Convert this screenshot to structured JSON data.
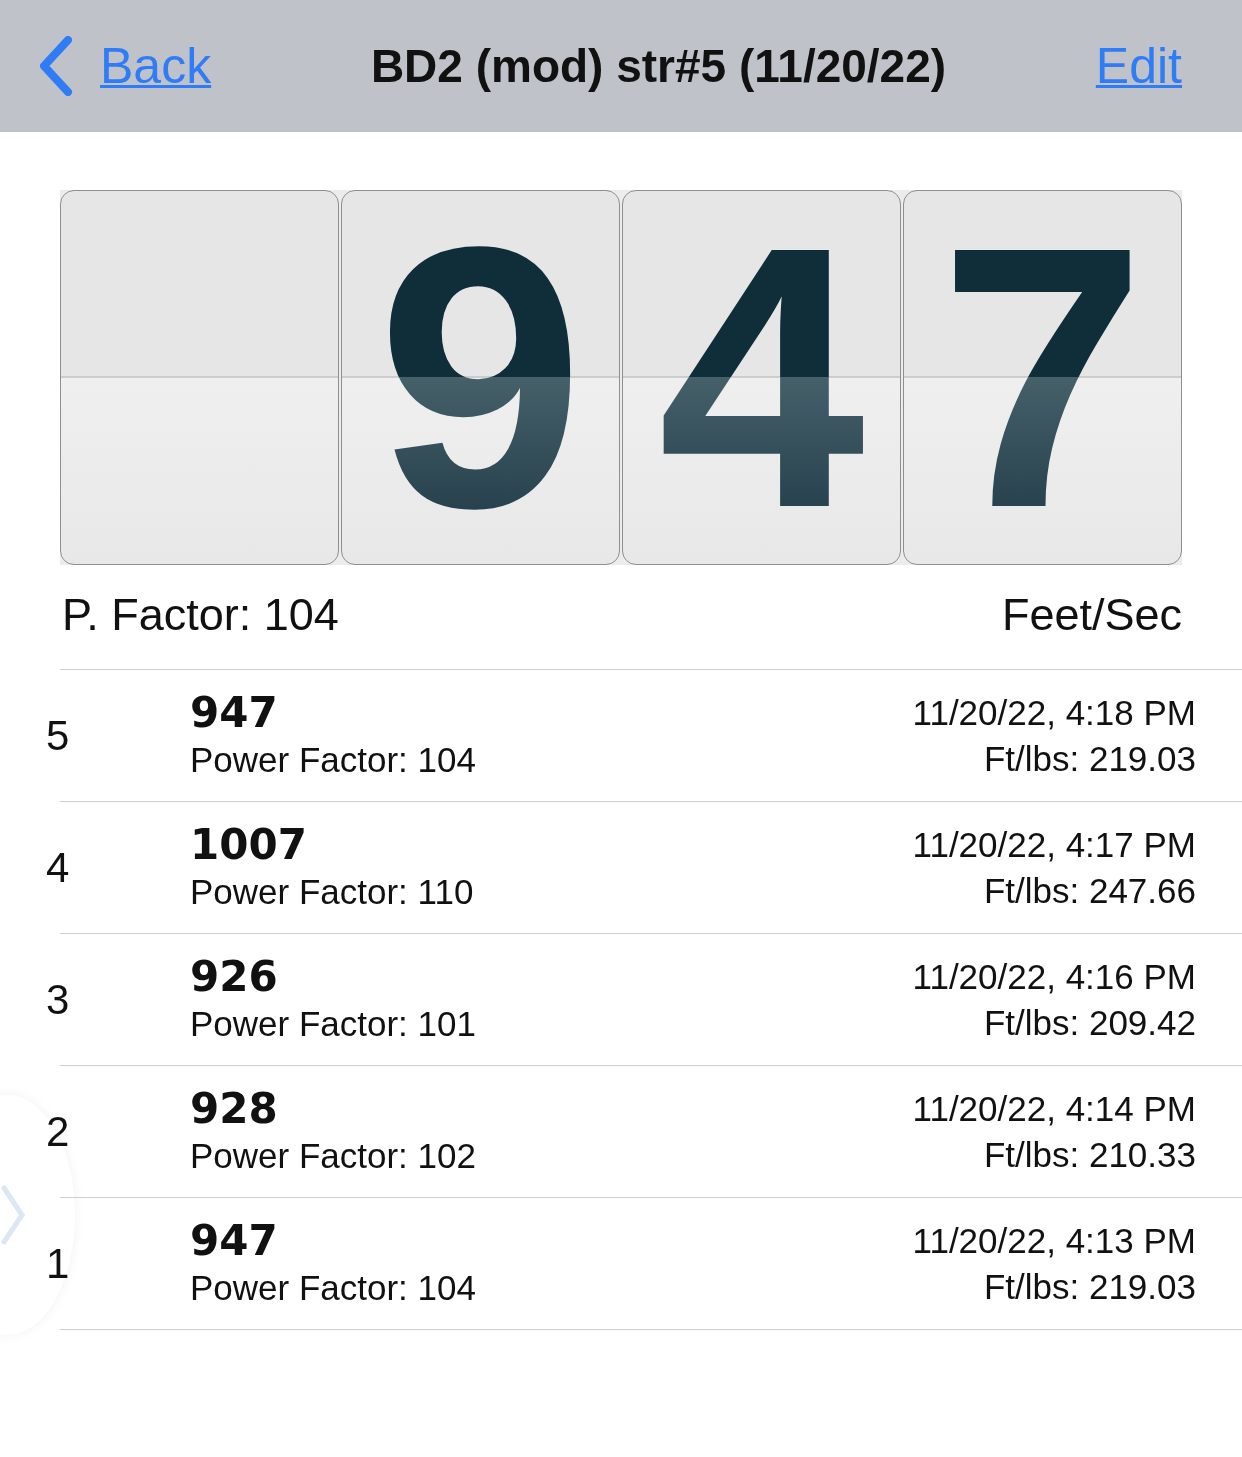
{
  "nav": {
    "back": "Back",
    "title": "BD2 (mod) str#5 (11/20/22)",
    "edit": "Edit"
  },
  "display": {
    "cards": [
      {
        "kind": "blank"
      },
      {
        "kind": "digit",
        "value": "9"
      },
      {
        "kind": "digit",
        "value": "4"
      },
      {
        "kind": "digit",
        "value": "7"
      }
    ]
  },
  "labels": {
    "left": "P. Factor: 104",
    "right": "Feet/Sec"
  },
  "shots": [
    {
      "index": "5",
      "speed": "947",
      "power": "Power Factor: 104",
      "time": "11/20/22, 4:18 PM",
      "energy": "Ft/lbs: 219.03"
    },
    {
      "index": "4",
      "speed": "1007",
      "power": "Power Factor: 110",
      "time": "11/20/22, 4:17 PM",
      "energy": "Ft/lbs: 247.66"
    },
    {
      "index": "3",
      "speed": "926",
      "power": "Power Factor: 101",
      "time": "11/20/22, 4:16 PM",
      "energy": "Ft/lbs: 209.42"
    },
    {
      "index": "2",
      "speed": "928",
      "power": "Power Factor: 102",
      "time": "11/20/22, 4:14 PM",
      "energy": "Ft/lbs: 210.33"
    },
    {
      "index": "1",
      "speed": "947",
      "power": "Power Factor: 104",
      "time": "11/20/22, 4:13 PM",
      "energy": "Ft/lbs: 219.03"
    }
  ]
}
